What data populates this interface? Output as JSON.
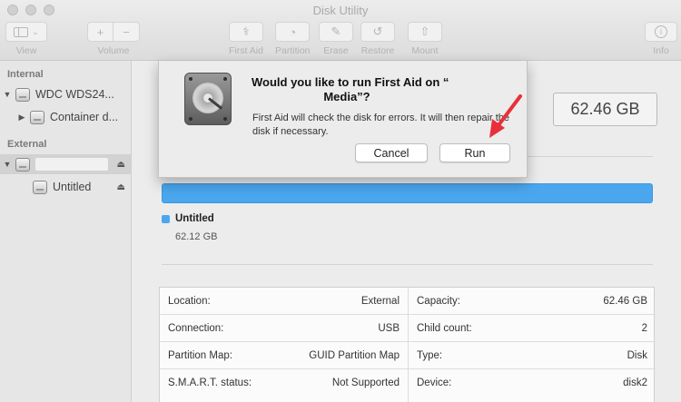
{
  "window": {
    "title": "Disk Utility"
  },
  "toolbar": {
    "view_label": "View",
    "volume_label": "Volume",
    "volume_add": "+",
    "volume_remove": "−",
    "first_aid_label": "First Aid",
    "partition_label": "Partition",
    "erase_label": "Erase",
    "restore_label": "Restore",
    "mount_label": "Mount",
    "info_label": "Info"
  },
  "sidebar": {
    "internal_header": "Internal",
    "external_header": "External",
    "items": [
      {
        "label": "WDC WDS24..."
      },
      {
        "label": "Container d..."
      },
      {
        "label": ""
      },
      {
        "label": "Untitled"
      }
    ]
  },
  "main": {
    "capacity_display": "62.46 GB",
    "usage_fraction": 1.0,
    "legend": {
      "name": "Untitled",
      "size": "62.12 GB"
    },
    "info_left": [
      {
        "key": "Location:",
        "value": "External"
      },
      {
        "key": "Connection:",
        "value": "USB"
      },
      {
        "key": "Partition Map:",
        "value": "GUID Partition Map"
      },
      {
        "key": "S.M.A.R.T. status:",
        "value": "Not Supported"
      }
    ],
    "info_right": [
      {
        "key": "Capacity:",
        "value": "62.46 GB"
      },
      {
        "key": "Child count:",
        "value": "2"
      },
      {
        "key": "Type:",
        "value": "Disk"
      },
      {
        "key": "Device:",
        "value": "disk2"
      }
    ]
  },
  "dialog": {
    "title_line1": "Would you like to run First Aid on “",
    "title_line2": "Media”?",
    "message": "First Aid will check the disk for errors. It will then repair the disk if necessary.",
    "cancel_label": "Cancel",
    "run_label": "Run"
  },
  "colors": {
    "accent": "#4aa7ee",
    "annotation_arrow": "#e8303a"
  }
}
